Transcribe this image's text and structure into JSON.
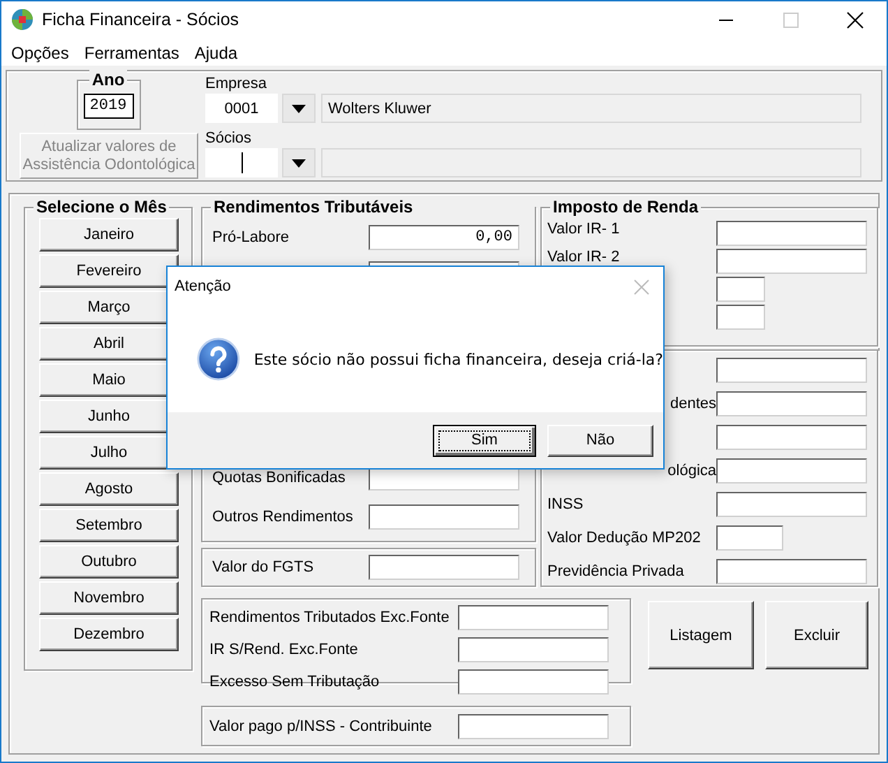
{
  "window": {
    "title": "Ficha Financeira - Sócios"
  },
  "menu": [
    "Opções",
    "Ferramentas",
    "Ajuda"
  ],
  "ano": {
    "label": "Ano",
    "value": "2019"
  },
  "update_button": {
    "lines": [
      "Atualizar valores de",
      "Assistência Odontológica"
    ],
    "disabled": true
  },
  "empresa": {
    "label": "Empresa",
    "code": "0001",
    "name": "Wolters Kluwer"
  },
  "socios": {
    "label": "Sócios",
    "focused": true
  },
  "months": {
    "title": "Selecione o Mês",
    "items": [
      "Janeiro",
      "Fevereiro",
      "Março",
      "Abril",
      "Maio",
      "Junho",
      "Julho",
      "Agosto",
      "Setembro",
      "Outubro",
      "Novembro",
      "Dezembro"
    ]
  },
  "rendimentos": {
    "title": "Rendimentos Tributáveis",
    "rows": [
      {
        "label": "Pró-Labore",
        "value": "0,00"
      }
    ],
    "rows_lower": [
      {
        "label": "Quotas Bonificadas"
      },
      {
        "label": "Outros Rendimentos"
      }
    ]
  },
  "fgts": {
    "label": "Valor do FGTS"
  },
  "imposto": {
    "title": "Imposto de Renda",
    "rows": [
      {
        "kind": "wide",
        "label": "Valor IR- 1"
      },
      {
        "kind": "wide",
        "label": "Valor IR- 2"
      },
      {
        "kind": "short"
      },
      {
        "kind": "short"
      }
    ]
  },
  "deducoes": {
    "rows": [
      {
        "kind": "wide"
      },
      {
        "kind": "wide",
        "label": "dentes",
        "cut": true
      },
      {
        "kind": "wide"
      },
      {
        "kind": "wide",
        "label": "ológica",
        "cut": true
      },
      {
        "kind": "wide",
        "label": "INSS"
      },
      {
        "kind": "medium",
        "label": "Valor Dedução MP202"
      },
      {
        "kind": "wide",
        "label": "Previdência Privada"
      }
    ]
  },
  "exc_fonte": {
    "rows": [
      "Rendimentos Tributados Exc.Fonte",
      "IR S/Rend. Exc.Fonte",
      "Excesso Sem Tributação"
    ]
  },
  "inss_contrib": {
    "label": "Valor pago p/INSS - Contribuinte"
  },
  "buttons": [
    "Listagem",
    "Excluir"
  ],
  "dialog": {
    "title": "Atenção",
    "message": "Este sócio não possui ficha financeira, deseja criá-la?",
    "buttons": [
      {
        "label": "Sim",
        "default": true
      },
      {
        "label": "Não",
        "default": false
      }
    ]
  }
}
